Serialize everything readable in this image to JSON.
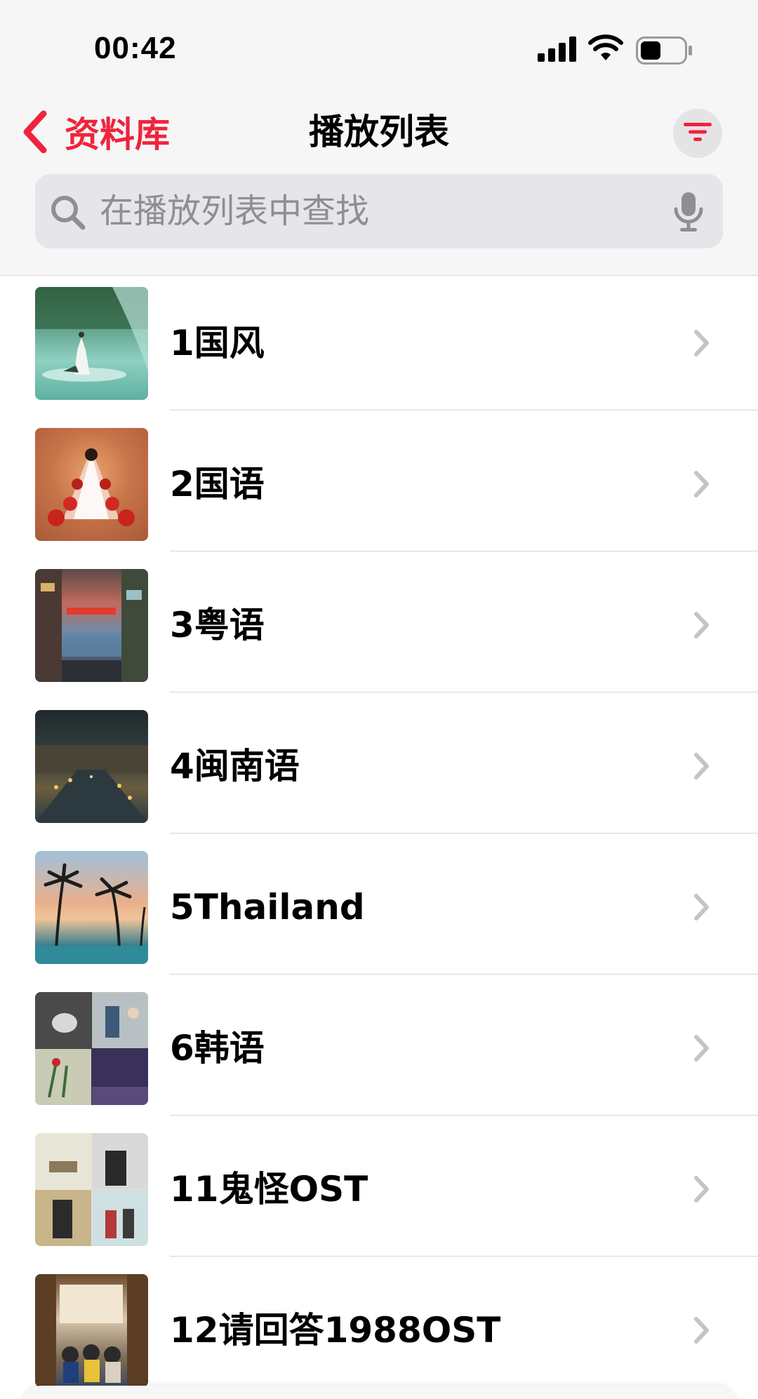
{
  "status_bar": {
    "time": "00:42"
  },
  "nav": {
    "back_label": "资料库",
    "title": "播放列表"
  },
  "search": {
    "placeholder": "在播放列表中查找"
  },
  "playlists": [
    {
      "title": "1国风"
    },
    {
      "title": "2国语"
    },
    {
      "title": "3粤语"
    },
    {
      "title": "4闽南语"
    },
    {
      "title": "5Thailand"
    },
    {
      "title": "6韩语"
    },
    {
      "title": "11鬼怪OST"
    },
    {
      "title": "12请回答1988OST"
    }
  ],
  "colors": {
    "accent": "#f0233c",
    "header_bg": "#f6f6f7",
    "search_bg": "#e5e5ea",
    "secondary_text": "#8e8e93"
  }
}
